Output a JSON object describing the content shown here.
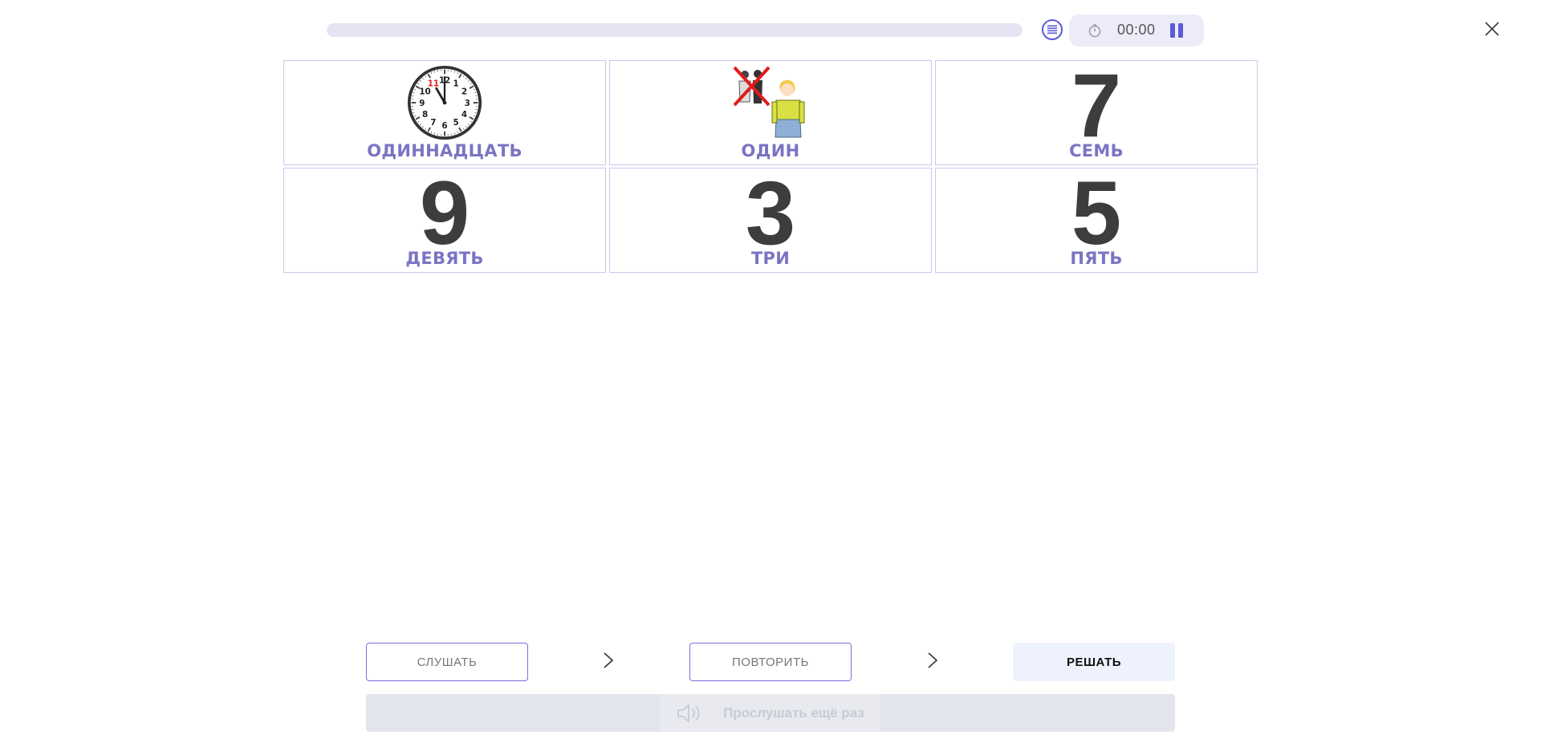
{
  "progress": {
    "fraction": 0.0
  },
  "toolbar": {
    "list_icon": "list-icon",
    "timer_icon": "stopwatch-icon",
    "timer_value": "00:00",
    "pause_icon": "pause-icon",
    "close_icon": "close-icon"
  },
  "cards": [
    {
      "type": "image",
      "image": "clock-eleven-icon",
      "label": "ОДИННАДЦАТЬ"
    },
    {
      "type": "image",
      "image": "one-person-icon",
      "label": "ОДИН"
    },
    {
      "type": "digit",
      "digit": "7",
      "label": "СЕМЬ"
    },
    {
      "type": "digit",
      "digit": "9",
      "label": "ДЕВЯТЬ"
    },
    {
      "type": "digit",
      "digit": "3",
      "label": "ТРИ"
    },
    {
      "type": "digit",
      "digit": "5",
      "label": "ПЯТЬ"
    }
  ],
  "clock": {
    "numbers": [
      "12",
      "1",
      "2",
      "3",
      "4",
      "5",
      "6",
      "7",
      "8",
      "9",
      "10",
      "11"
    ]
  },
  "steps": {
    "listen_label": "СЛУШАТЬ",
    "repeat_label": "ПОВТОРИТЬ",
    "solve_label": "РЕШАТЬ"
  },
  "listen_again": {
    "icon": "speaker-icon",
    "label": "Прослушать ещё раз"
  },
  "colors": {
    "accent": "#5b5bd6",
    "label_purple": "#7b74c4",
    "card_border": "#c9c7ee",
    "progress_track": "#e6e4f3"
  }
}
